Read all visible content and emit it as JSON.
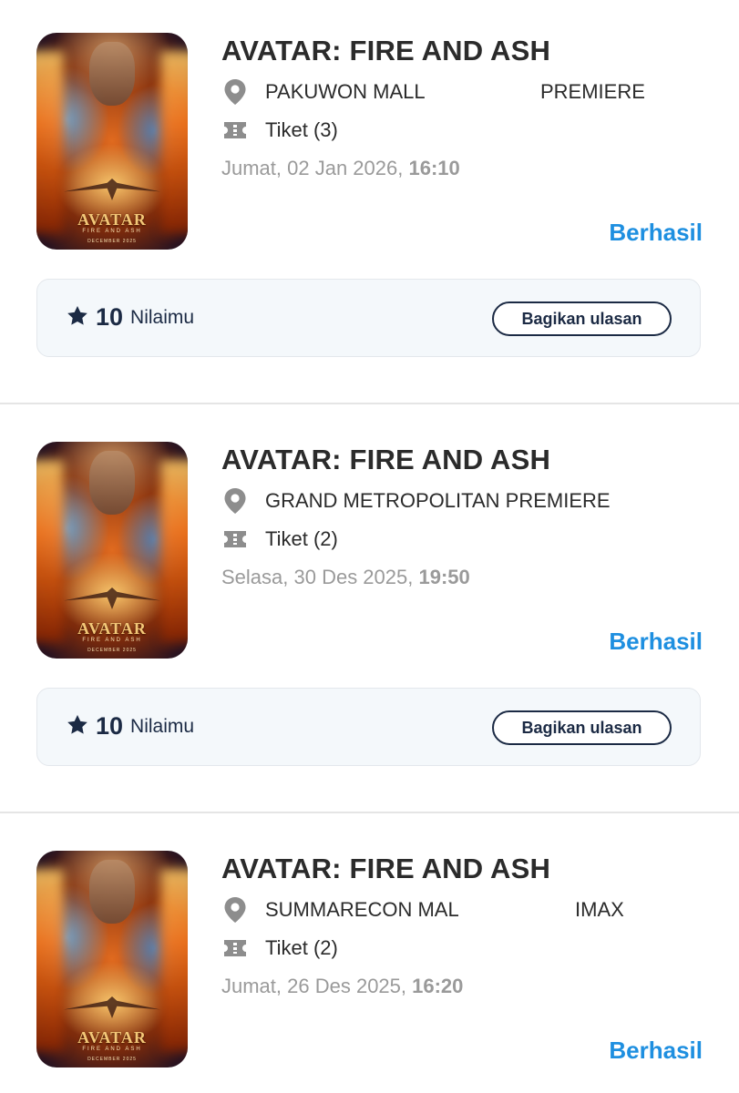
{
  "orders": [
    {
      "title": "AVATAR: FIRE AND ASH",
      "cinema": "PAKUWON MALL",
      "studio": "PREMIERE",
      "tickets": "Tiket (3)",
      "date": "Jumat, 02 Jan 2026, ",
      "time": "16:10",
      "status": "Berhasil",
      "rating": "10",
      "rating_label": "Nilaimu",
      "share_label": "Bagikan ulasan",
      "poster": {
        "logo": "AVATAR",
        "subtitle": "FIRE AND ASH",
        "release": "DECEMBER 2025"
      }
    },
    {
      "title": "AVATAR: FIRE AND ASH",
      "cinema": "GRAND METROPOLITAN",
      "studio": "PREMIERE",
      "tickets": "Tiket (2)",
      "date": "Selasa, 30 Des 2025, ",
      "time": "19:50",
      "status": "Berhasil",
      "rating": "10",
      "rating_label": "Nilaimu",
      "share_label": "Bagikan ulasan",
      "poster": {
        "logo": "AVATAR",
        "subtitle": "FIRE AND ASH",
        "release": "DECEMBER 2025"
      }
    },
    {
      "title": "AVATAR: FIRE AND ASH",
      "cinema": "SUMMARECON MAL",
      "studio": "IMAX",
      "tickets": "Tiket (2)",
      "date": "Jumat, 26 Des 2025, ",
      "time": "16:20",
      "status": "Berhasil",
      "poster": {
        "logo": "AVATAR",
        "subtitle": "FIRE AND ASH",
        "release": "DECEMBER 2025"
      }
    }
  ],
  "colors": {
    "status": "#1e8fe0",
    "navy": "#1b2a44",
    "muted": "#9a9a9a"
  },
  "icons": {
    "location": "map-pin-icon",
    "ticket": "ticket-icon",
    "rating": "star-icon"
  }
}
